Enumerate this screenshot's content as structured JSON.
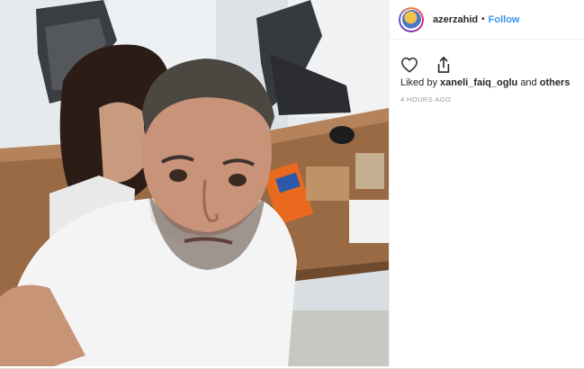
{
  "post": {
    "username": "azerzahid",
    "separator": "•",
    "follow_label": "Follow",
    "likes_prefix": "Liked by",
    "liked_by_user": "xaneli_faiq_oglu",
    "likes_conjunction": "and",
    "likes_others": "others",
    "timestamp": "4 HOURS AGO"
  },
  "icons": {
    "like": "heart-icon",
    "share": "share-icon",
    "avatar": "profile-avatar"
  },
  "colors": {
    "follow_link": "#3897f0",
    "text_primary": "#262626",
    "text_muted": "#999999"
  }
}
